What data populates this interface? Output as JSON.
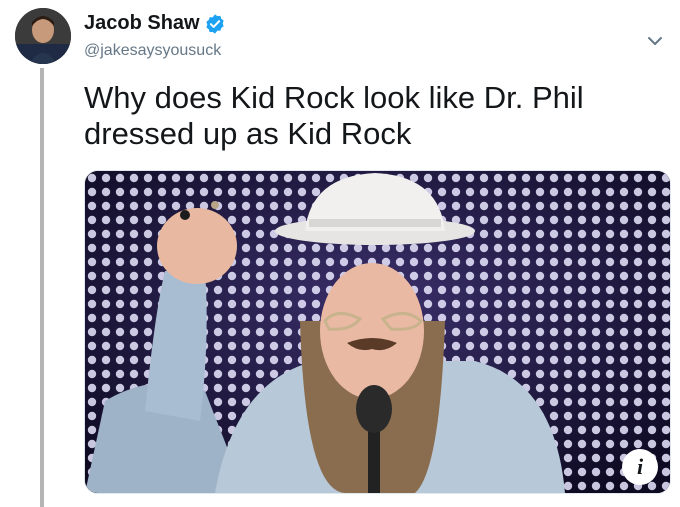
{
  "tweet": {
    "display_name": "Jacob Shaw",
    "handle": "@jakesaysyousuck",
    "text_line1": "Why does Kid Rock look like Dr. Phil",
    "text_line2": "dressed up as Kid Rock",
    "verified": true
  },
  "icons": {
    "verified": "verified-badge-icon",
    "menu": "chevron-down-icon",
    "info": "info-icon"
  },
  "card": {
    "info_glyph": "i"
  },
  "colors": {
    "verified_blue": "#1da1f2",
    "handle_gray": "#657786",
    "thread_line": "#b5b5b5",
    "stage_purple": "#2a1f4e"
  }
}
